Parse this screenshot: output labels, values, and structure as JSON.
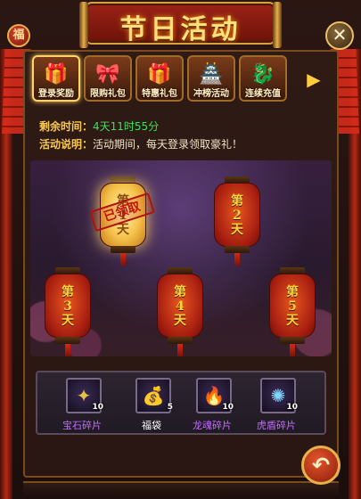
{
  "title": "节日活动",
  "corner_button_label": "福",
  "close_glyph": "✕",
  "tabs": [
    {
      "label": "登录奖励",
      "icon": "treasure-chest-icon",
      "glyph": "🎁",
      "active": true
    },
    {
      "label": "限购礼包",
      "icon": "gift-box-icon",
      "glyph": "🎀",
      "active": false
    },
    {
      "label": "特惠礼包",
      "icon": "gift-box-icon",
      "glyph": "🎁",
      "active": false
    },
    {
      "label": "冲榜活动",
      "icon": "gold-pagoda-icon",
      "glyph": "🏯",
      "active": false
    },
    {
      "label": "连续充值",
      "icon": "dragon-icon",
      "glyph": "🐉",
      "active": false
    }
  ],
  "tab_more_glyph": "▶",
  "info": {
    "remaining_label": "剩余时间：",
    "remaining_value": "4天11时55分",
    "desc_label": "活动说明：",
    "desc_value": "活动期间，每天登录领取豪礼！"
  },
  "lanterns": [
    {
      "label": "第\n1\n天",
      "claimed": true
    },
    {
      "label": "第\n2\n天",
      "claimed": false
    },
    {
      "label": "第\n3\n天",
      "claimed": false
    },
    {
      "label": "第\n4\n天",
      "claimed": false
    },
    {
      "label": "第\n5\n天",
      "claimed": false
    }
  ],
  "claimed_stamp": "已领取",
  "rewards": [
    {
      "name": "宝石碎片",
      "count": "10",
      "icon": "gem-shards-icon",
      "glyph": "✦",
      "name_color": "#c36bff"
    },
    {
      "name": "福袋",
      "count": "5",
      "icon": "lucky-bag-icon",
      "glyph": "💰",
      "name_color": "#ffffff"
    },
    {
      "name": "龙魂碎片",
      "count": "10",
      "icon": "dragon-soul-icon",
      "glyph": "🔥",
      "name_color": "#c36bff"
    },
    {
      "name": "虎盾碎片",
      "count": "10",
      "icon": "tiger-shield-icon",
      "glyph": "✺",
      "name_color": "#c36bff"
    }
  ],
  "back_glyph": "↶"
}
